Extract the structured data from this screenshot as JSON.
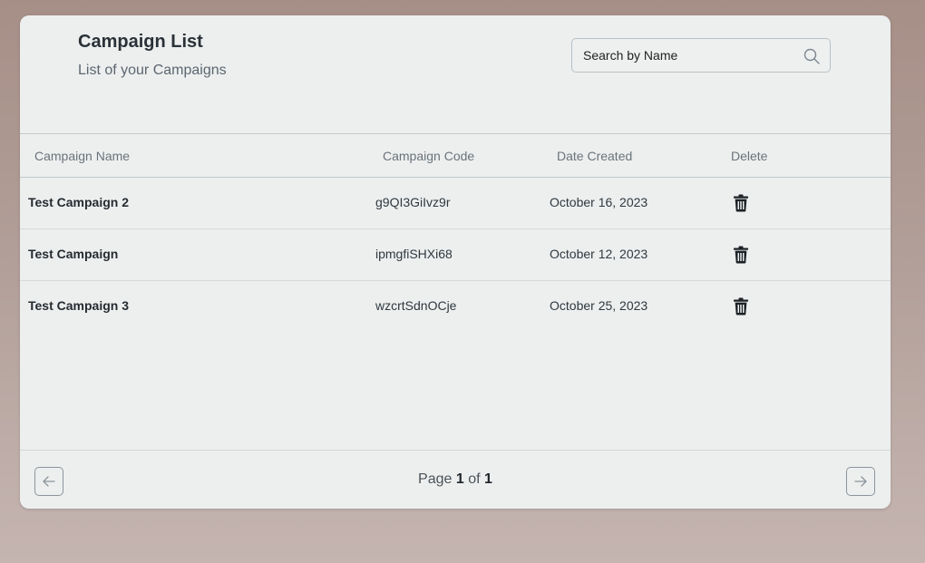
{
  "header": {
    "title": "Campaign List",
    "subtitle": "List of your Campaigns"
  },
  "search": {
    "placeholder": "Search by Name",
    "icon": "search-icon"
  },
  "table": {
    "columns": [
      "Campaign Name",
      "Campaign Code",
      "Date Created",
      "Delete"
    ],
    "rows": [
      {
        "name": "Test Campaign 2",
        "code": "g9QI3GiIvz9r",
        "date": "October 16, 2023",
        "delete_icon": "trash-icon"
      },
      {
        "name": "Test Campaign",
        "code": "ipmgfiSHXi68",
        "date": "October 12, 2023",
        "delete_icon": "trash-icon"
      },
      {
        "name": "Test Campaign 3",
        "code": "wzcrtSdnOCje",
        "date": "October 25, 2023",
        "delete_icon": "trash-icon"
      }
    ]
  },
  "pagination": {
    "page_label": "Page",
    "current_page": "1",
    "of_label": "of",
    "total_pages": "1",
    "prev_icon": "arrow-left-icon",
    "next_icon": "arrow-right-icon"
  },
  "colors": {
    "card_background": "#edefef",
    "page_background": "#a68f87",
    "heading": "#2a3238"
  }
}
